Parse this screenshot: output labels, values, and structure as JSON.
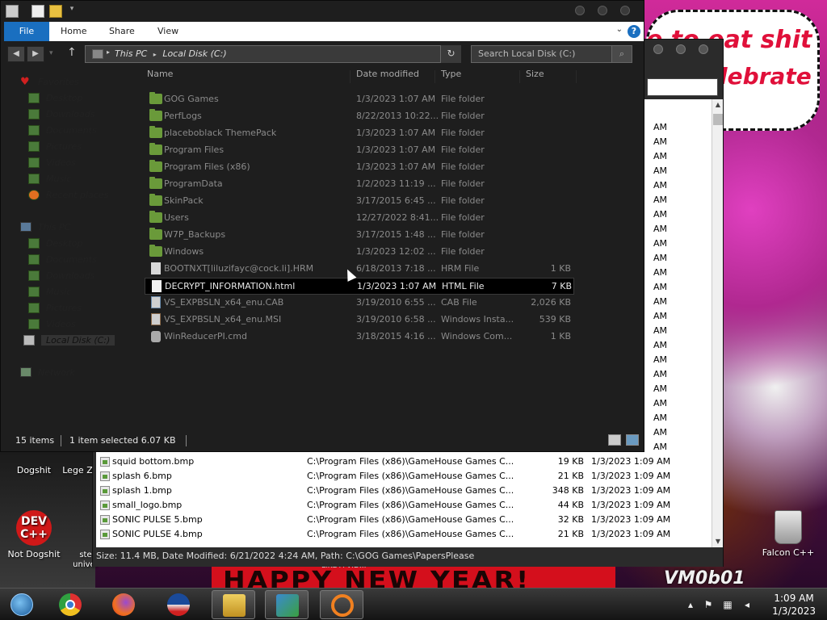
{
  "desktop": {
    "bubble_line1": "e to eat shit",
    "bubble_line2": "elebrate",
    "banner_text": "HAPPY NEW YEAR!",
    "banner_small": "LIKE A VID...",
    "vm_text": "VM0b01",
    "icons": [
      {
        "label": "Dogshit"
      },
      {
        "label": "Lege Z"
      },
      {
        "label": "Not Dogshit"
      },
      {
        "label": "ste univer"
      },
      {
        "label": "Falcon C++"
      }
    ],
    "dev_logo_text": "DEV C++"
  },
  "back_window": {
    "rows": [
      {
        "name": "squid bottom.bmp",
        "path": "C:\\Program Files (x86)\\GameHouse Games C...",
        "size": "19 KB",
        "date": "1/3/2023 1:09 AM"
      },
      {
        "name": "splash 6.bmp",
        "path": "C:\\Program Files (x86)\\GameHouse Games C...",
        "size": "21 KB",
        "date": "1/3/2023 1:09 AM"
      },
      {
        "name": "splash 1.bmp",
        "path": "C:\\Program Files (x86)\\GameHouse Games C...",
        "size": "348 KB",
        "date": "1/3/2023 1:09 AM"
      },
      {
        "name": "small_logo.bmp",
        "path": "C:\\Program Files (x86)\\GameHouse Games C...",
        "size": "44 KB",
        "date": "1/3/2023 1:09 AM"
      },
      {
        "name": "SONIC PULSE 5.bmp",
        "path": "C:\\Program Files (x86)\\GameHouse Games C...",
        "size": "32 KB",
        "date": "1/3/2023 1:09 AM"
      },
      {
        "name": "SONIC PULSE 4.bmp",
        "path": "C:\\Program Files (x86)\\GameHouse Games C...",
        "size": "21 KB",
        "date": "1/3/2023 1:09 AM"
      }
    ],
    "am_label": "AM",
    "status": "Size: 11.4 MB, Date Modified: 6/21/2022 4:24 AM, Path: C:\\GOG Games\\PapersPlease"
  },
  "explorer": {
    "ribbon_tabs": [
      "File",
      "Home",
      "Share",
      "View"
    ],
    "help": "?",
    "address": {
      "segment1": "This PC",
      "segment2": "Local Disk (C:)"
    },
    "search_placeholder": "Search Local Disk (C:)",
    "nav": {
      "favorites": "Favorites",
      "fav_items": [
        "Desktop",
        "Downloads",
        "Documents",
        "Pictures",
        "Videos",
        "Music",
        "Recent places"
      ],
      "this_pc": "This PC",
      "pc_items": [
        "Desktop",
        "Documents",
        "Downloads",
        "Music",
        "Pictures",
        "Videos",
        "Local Disk (C:)"
      ],
      "network": "Network"
    },
    "columns": [
      "Name",
      "Date modified",
      "Type",
      "Size"
    ],
    "files": [
      {
        "name": "GOG Games",
        "date": "1/3/2023 1:07 AM",
        "type": "File folder",
        "size": "",
        "kind": "folder"
      },
      {
        "name": "PerfLogs",
        "date": "8/22/2013 10:22...",
        "type": "File folder",
        "size": "",
        "kind": "folder"
      },
      {
        "name": "placeboblack ThemePack",
        "date": "1/3/2023 1:07 AM",
        "type": "File folder",
        "size": "",
        "kind": "folder"
      },
      {
        "name": "Program Files",
        "date": "1/3/2023 1:07 AM",
        "type": "File folder",
        "size": "",
        "kind": "folder"
      },
      {
        "name": "Program Files (x86)",
        "date": "1/3/2023 1:07 AM",
        "type": "File folder",
        "size": "",
        "kind": "folder"
      },
      {
        "name": "ProgramData",
        "date": "1/2/2023 11:19 ...",
        "type": "File folder",
        "size": "",
        "kind": "folder"
      },
      {
        "name": "SkinPack",
        "date": "3/17/2015 6:45 ...",
        "type": "File folder",
        "size": "",
        "kind": "folder"
      },
      {
        "name": "Users",
        "date": "12/27/2022 8:41...",
        "type": "File folder",
        "size": "",
        "kind": "folder"
      },
      {
        "name": "W7P_Backups",
        "date": "3/17/2015 1:48 ...",
        "type": "File folder",
        "size": "",
        "kind": "folder"
      },
      {
        "name": "Windows",
        "date": "1/3/2023 12:02 ...",
        "type": "File folder",
        "size": "",
        "kind": "folder"
      },
      {
        "name": "BOOTNXT[liluzifayc@cock.li].HRM",
        "date": "6/18/2013 7:18 ...",
        "type": "HRM File",
        "size": "1 KB",
        "kind": "file"
      },
      {
        "name": "DECRYPT_INFORMATION.html",
        "date": "1/3/2023 1:07 AM",
        "type": "HTML File",
        "size": "7 KB",
        "kind": "html"
      },
      {
        "name": "VS_EXPBSLN_x64_enu.CAB",
        "date": "3/19/2010 6:55 ...",
        "type": "CAB File",
        "size": "2,026 KB",
        "kind": "cab"
      },
      {
        "name": "VS_EXPBSLN_x64_enu.MSI",
        "date": "3/19/2010 6:58 ...",
        "type": "Windows Insta...",
        "size": "539 KB",
        "kind": "msi"
      },
      {
        "name": "WinReducerPI.cmd",
        "date": "3/18/2015 4:16 ...",
        "type": "Windows Com...",
        "size": "1 KB",
        "kind": "cmd"
      }
    ],
    "selected_index": 11,
    "status": {
      "items": "15 items",
      "selected": "1 item selected  6.07 KB"
    }
  },
  "taskbar": {
    "clock_time": "1:09 AM",
    "clock_date": "1/3/2023"
  }
}
